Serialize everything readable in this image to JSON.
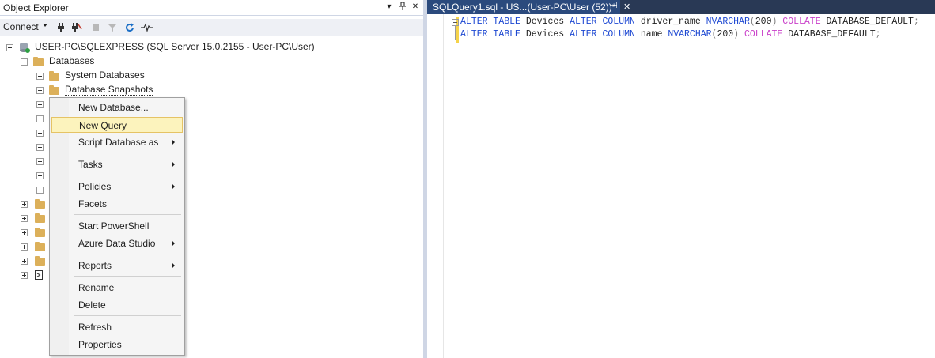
{
  "object_explorer": {
    "title": "Object Explorer",
    "title_controls": {
      "dropdown": "▾",
      "pin": "📌",
      "close": "✕"
    },
    "toolbar": {
      "connect_label": "Connect"
    },
    "tree": {
      "server": "USER-PC\\SQLEXPRESS (SQL Server 15.0.2155 - User-PC\\User)",
      "databases": "Databases",
      "system_databases": "System Databases",
      "database_snapshots": "Database Snapshots"
    }
  },
  "editor": {
    "tab_title": "SQLQuery1.sql - US...(User-PC\\User (52))*",
    "tab_pin": "⊣",
    "tab_close": "✕",
    "lines": [
      {
        "kw1": "ALTER",
        "kw2": "TABLE",
        "t1": "Devices",
        "kw3": "ALTER",
        "kw4": "COLUMN",
        "t2": "driver_name",
        "ty": "NVARCHAR",
        "p1": "(",
        "num": "200",
        "p2": ")",
        "col": "COLLATE",
        "t3": "DATABASE_DEFAULT",
        "end": ";"
      },
      {
        "kw1": "ALTER",
        "kw2": "TABLE",
        "t1": "Devices",
        "kw3": "ALTER",
        "kw4": "COLUMN",
        "t2": "name",
        "ty": "NVARCHAR",
        "p1": "(",
        "num": "200",
        "p2": ")",
        "col": "COLLATE",
        "t3": "DATABASE_DEFAULT",
        "end": ";"
      }
    ]
  },
  "context_menu": {
    "items": [
      {
        "label": "New Database..."
      },
      {
        "label": "New Query"
      },
      {
        "label": "Script Database as"
      },
      {
        "label": "Tasks"
      },
      {
        "label": "Policies"
      },
      {
        "label": "Facets"
      },
      {
        "label": "Start PowerShell"
      },
      {
        "label": "Azure Data Studio"
      },
      {
        "label": "Reports"
      },
      {
        "label": "Rename"
      },
      {
        "label": "Delete"
      },
      {
        "label": "Refresh"
      },
      {
        "label": "Properties"
      }
    ]
  },
  "colors": {
    "tab_background": "#2b4a7d",
    "tabstrip_background": "#293955",
    "highlight": "#fcf3bd",
    "keyword": "#1d48d2",
    "function": "#c93fc9"
  }
}
